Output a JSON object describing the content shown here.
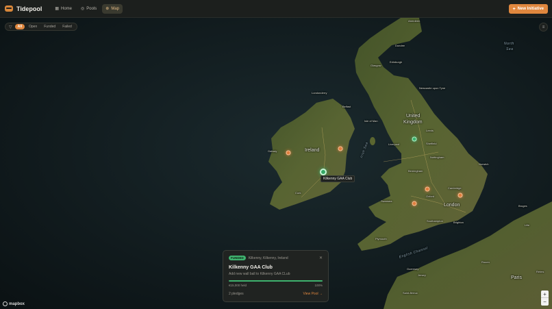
{
  "app": {
    "name": "Tidepool"
  },
  "nav": {
    "items": [
      {
        "label": "Home",
        "icon": "home-icon"
      },
      {
        "label": "Pools",
        "icon": "pools-icon"
      },
      {
        "label": "Map",
        "icon": "globe-icon",
        "active": true
      }
    ],
    "new_button": "New Initiative"
  },
  "filters": {
    "options": [
      "All",
      "Open",
      "Funded",
      "Failed"
    ],
    "selected": "All"
  },
  "map": {
    "labels": {
      "countries": [
        "Ireland",
        "United",
        "Kingdom"
      ],
      "seas": [
        "North",
        "Sea",
        "Irish Sea",
        "English Channel"
      ],
      "places": [
        "Aberdeen",
        "Dundee",
        "Glasgow",
        "Edinburgh",
        "Londonderry",
        "Belfast",
        "Isle of Man",
        "Newcastle upon Tyne",
        "Leeds",
        "Liverpool",
        "Sheffield",
        "Nottingham",
        "Norwich",
        "Birmingham",
        "Cambridge",
        "Oxford",
        "Swansea",
        "London",
        "Southampton",
        "Brighton",
        "Plymouth",
        "Cork",
        "Galway",
        "Guernsey",
        "Jersey",
        "Rouen",
        "Paris",
        "Bruges",
        "Lille",
        "Saint-Brieuc",
        "Reims"
      ]
    },
    "tooltip": "Kilkenny GAA Club",
    "markers": [
      {
        "name": "Kilkenny GAA Club",
        "status": "Funded",
        "selected": true
      },
      {
        "status": "Open"
      },
      {
        "status": "Open"
      },
      {
        "status": "Funded"
      },
      {
        "status": "Open"
      },
      {
        "status": "Open"
      },
      {
        "status": "Open"
      }
    ],
    "colors": {
      "open": "#e07f3e",
      "funded": "#3fb36f",
      "accent": "#e0873e"
    }
  },
  "popup": {
    "badge": "FUNDED",
    "location": "Kilkenny, Kilkenny, Ireland",
    "title": "Kilkenny GAA Club",
    "description": "Add new wall ball to Kilkenny GAA CLub",
    "held": "€15,000 held",
    "percent_label": "100%",
    "progress": 1.0,
    "pledges": "2 pledges",
    "view_link": "View Pool →"
  },
  "attribution": "mapbox"
}
